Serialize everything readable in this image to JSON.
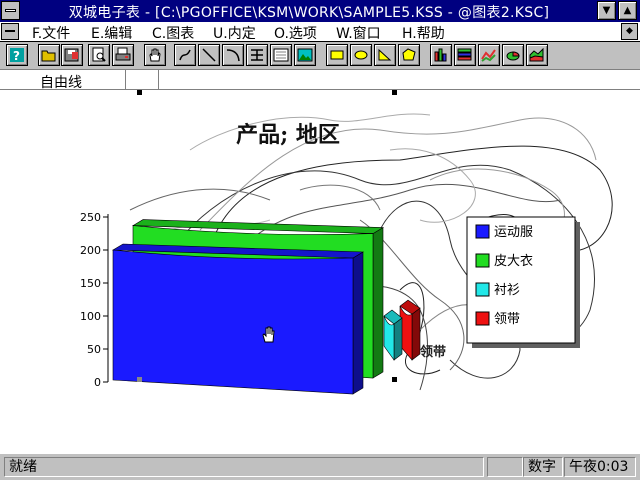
{
  "window": {
    "title": "双城电子表 - [C:\\PGOFFICE\\KSM\\WORK\\SAMPLE5.KSS - @图表2.KSC]",
    "minimize_glyph": "▼",
    "maximize_glyph": "▲",
    "restore_glyph": "◆"
  },
  "menu": {
    "items": [
      "F.文件",
      "E.编辑",
      "C.图表",
      "U.内定",
      "O.选项",
      "W.窗口",
      "H.帮助"
    ]
  },
  "toolbar": {
    "buttons": [
      "help",
      "open",
      "save",
      "print-preview",
      "print",
      "hand",
      "freehand",
      "line",
      "arc",
      "text",
      "list",
      "picture",
      "rectangle",
      "ellipse",
      "triangle",
      "polygon",
      "bar-chart",
      "stacked-bar",
      "line-chart",
      "pie-chart",
      "area-chart"
    ]
  },
  "formatbar": {
    "tool_label": "自由线"
  },
  "chart_data": {
    "type": "bar",
    "title": "产品; 地区",
    "categories": [
      "运动服",
      "皮大衣",
      "衬衫",
      "领带"
    ],
    "series": [
      {
        "name": "运动服",
        "color": "#1a1aff",
        "values": [
          200
        ]
      },
      {
        "name": "皮大衣",
        "color": "#22dd22",
        "values": [
          237
        ]
      },
      {
        "name": "衬衫",
        "color": "#22e8e8",
        "values": [
          100
        ]
      },
      {
        "name": "领带",
        "color": "#ee1111",
        "values": [
          115
        ]
      }
    ],
    "yticks": [
      0,
      50,
      100,
      150,
      200,
      250
    ],
    "ylim": [
      0,
      250
    ],
    "axis_annotation": "领带",
    "legend_position": "right",
    "grid": false,
    "style": "3d"
  },
  "status": {
    "ready": "就绪",
    "mode": "数字",
    "time": "午夜0:03"
  }
}
